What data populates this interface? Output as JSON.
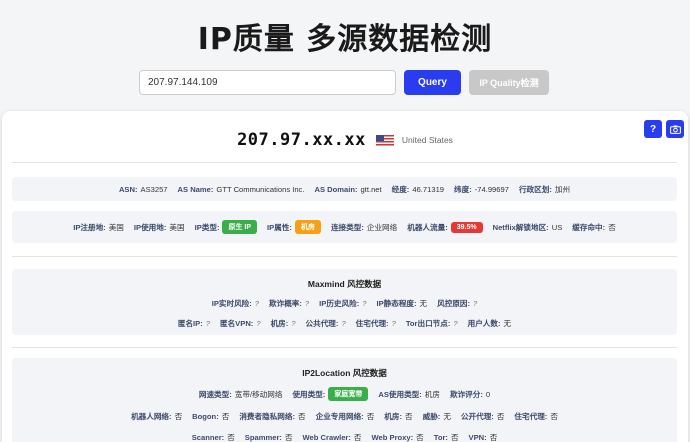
{
  "page": {
    "title": "IP质量 多源数据检测"
  },
  "search": {
    "value": "207.97.144.109",
    "query_label": "Query",
    "ipq_label": "IP Quality检测"
  },
  "header": {
    "ip_masked": "207.97.xx.xx",
    "country": "United States",
    "help_label": "?",
    "camera_icon": "camera-icon"
  },
  "basic": {
    "asn_label": "ASN:",
    "asn": "AS3257",
    "as_name_label": "AS Name:",
    "as_name": "GTT Communications Inc.",
    "as_domain_label": "AS Domain:",
    "as_domain": "gtt.net",
    "lon_label": "经度:",
    "lon": "46.71319",
    "lat_label": "纬度:",
    "lat": "-74.99697",
    "region_label": "行政区划:",
    "region": "加州"
  },
  "attrs": {
    "reg_label": "IP注册地:",
    "reg": "美国",
    "use_label": "IP使用地:",
    "use": "美国",
    "type_label": "IP类型:",
    "type": "原生 IP",
    "prop_label": "IP属性:",
    "prop": "机房",
    "conn_label": "连接类型:",
    "conn": "企业网络",
    "bot_label": "机器人流量:",
    "bot": "39.5%",
    "netflix_label": "Netflix解锁地区:",
    "netflix": "US",
    "cache_label": "缓存命中:",
    "cache": "否"
  },
  "maxmind": {
    "title": "Maxmind 风控数据",
    "row1": [
      {
        "k": "IP实时风险:",
        "v": "?"
      },
      {
        "k": "欺诈概率:",
        "v": "?"
      },
      {
        "k": "IP历史风险:",
        "v": "?"
      },
      {
        "k": "IP静态程度:",
        "v": "无"
      },
      {
        "k": "风控原因:",
        "v": "?"
      }
    ],
    "row2": [
      {
        "k": "匿名IP:",
        "v": "?"
      },
      {
        "k": "匿名VPN:",
        "v": "?"
      },
      {
        "k": "机房:",
        "v": "?"
      },
      {
        "k": "公共代理:",
        "v": "?"
      },
      {
        "k": "住宅代理:",
        "v": "?"
      },
      {
        "k": "Tor出口节点:",
        "v": "?"
      },
      {
        "k": "用户人数:",
        "v": "无"
      }
    ]
  },
  "ip2location": {
    "title": "IP2Location 风控数据",
    "row1": [
      {
        "k": "网速类型:",
        "v": "宽带/移动网络"
      },
      {
        "k": "使用类型:",
        "v": "家庭宽带"
      },
      {
        "k": "AS使用类型:",
        "v": "机房"
      },
      {
        "k": "欺诈评分:",
        "v": "0"
      }
    ],
    "row2": [
      {
        "k": "机器人网络:",
        "v": "否"
      },
      {
        "k": "Bogon:",
        "v": "否"
      },
      {
        "k": "消费者隐私网络:",
        "v": "否"
      },
      {
        "k": "企业专用网络:",
        "v": "否"
      },
      {
        "k": "机房:",
        "v": "否"
      },
      {
        "k": "威胁:",
        "v": "无"
      },
      {
        "k": "公开代理:",
        "v": "否"
      },
      {
        "k": "住宅代理:",
        "v": "否"
      }
    ],
    "row3": [
      {
        "k": "Scanner:",
        "v": "否"
      },
      {
        "k": "Spammer:",
        "v": "否"
      },
      {
        "k": "Web Crawler:",
        "v": "否"
      },
      {
        "k": "Web Proxy:",
        "v": "否"
      },
      {
        "k": "Tor:",
        "v": "否"
      },
      {
        "k": "VPN:",
        "v": "否"
      }
    ]
  },
  "colors": {
    "accent": "#2a3cf0",
    "green": "#3aae4a",
    "orange": "#f5a015",
    "red": "#e53935"
  }
}
